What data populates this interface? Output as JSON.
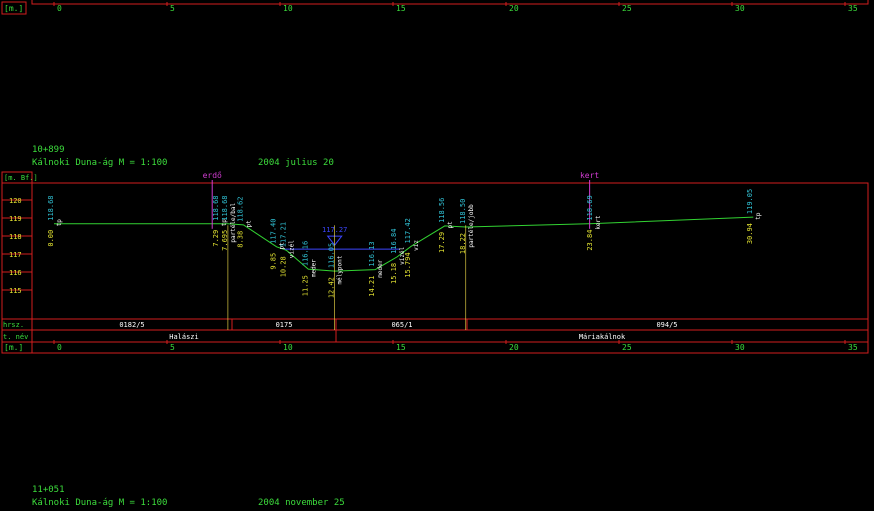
{
  "colors": {
    "background": "#000000",
    "frame": "#d21e1e",
    "green_text": "#3cdc3c",
    "yellow_text": "#e6e632",
    "cyan_text": "#32c8dc",
    "white_text": "#ffffff",
    "magenta": "#d23cd2",
    "blue": "#3c46ff",
    "ground_line": "#32d232"
  },
  "top_axis": {
    "unit_label": "[m.]",
    "ticks": [
      "0",
      "5",
      "10",
      "15",
      "20",
      "25",
      "30",
      "35"
    ]
  },
  "section1": {
    "station": "10+899",
    "project_title": "Kálnoki Duna-ág M = 1:100",
    "date": "2004 julius 20",
    "elevation_unit": "[m. Bf.]",
    "elevation_ticks": [
      "120",
      "119",
      "118",
      "117",
      "116",
      "115"
    ],
    "markers": [
      {
        "name": "erdo-marker",
        "label": "erdő",
        "station_m": 7
      },
      {
        "name": "kert-marker",
        "label": "kert",
        "station_m": 23.7
      }
    ],
    "water_level": {
      "value": "117.27"
    },
    "points": [
      {
        "distance": "0.00",
        "elevation": "118.68",
        "code": "tp"
      },
      {
        "distance": "7.29",
        "elevation": "118.68",
        "code": "tp"
      },
      {
        "distance": "7.695",
        "elevation": "118.68",
        "code": "partéle/bal"
      },
      {
        "distance": "8.38",
        "elevation": "118.62",
        "code": "pt"
      },
      {
        "distance": "9.85",
        "elevation": "117.40",
        "code": "pt"
      },
      {
        "distance": "10.28",
        "elevation": "117.21",
        "code": "vízél"
      },
      {
        "distance": "11.25",
        "elevation": "116.16",
        "code": "meder"
      },
      {
        "distance": "12.42",
        "elevation": "116.05",
        "code": "mélypont"
      },
      {
        "distance": "14.21",
        "elevation": "116.13",
        "code": "meder"
      },
      {
        "distance": "15.18",
        "elevation": "116.84",
        "code": "vízél"
      },
      {
        "distance": "15.794",
        "elevation": "117.42",
        "code": "víz"
      },
      {
        "distance": "17.29",
        "elevation": "118.56",
        "code": "pt"
      },
      {
        "distance": "18.22",
        "elevation": "118.50",
        "code": "partéle/jobb"
      },
      {
        "distance": "23.84",
        "elevation": "118.69",
        "code": "kert"
      },
      {
        "distance": "30.94",
        "elevation": "119.05",
        "code": "tp"
      }
    ],
    "parcel_row": {
      "label": "hrsz.",
      "values": [
        "0182/5",
        "0175",
        "065/1",
        "094/5"
      ]
    },
    "name_row": {
      "label": "t. név",
      "values": [
        "Halászi",
        "Máriakálnok"
      ]
    }
  },
  "bottom_axis": {
    "unit_label": "[m.]",
    "ticks": [
      "0",
      "5",
      "10",
      "15",
      "20",
      "25",
      "30",
      "35"
    ]
  },
  "section2": {
    "station": "11+051",
    "project_title": "Kálnoki Duna-ág M = 1:100",
    "date": "2004 november 25"
  }
}
